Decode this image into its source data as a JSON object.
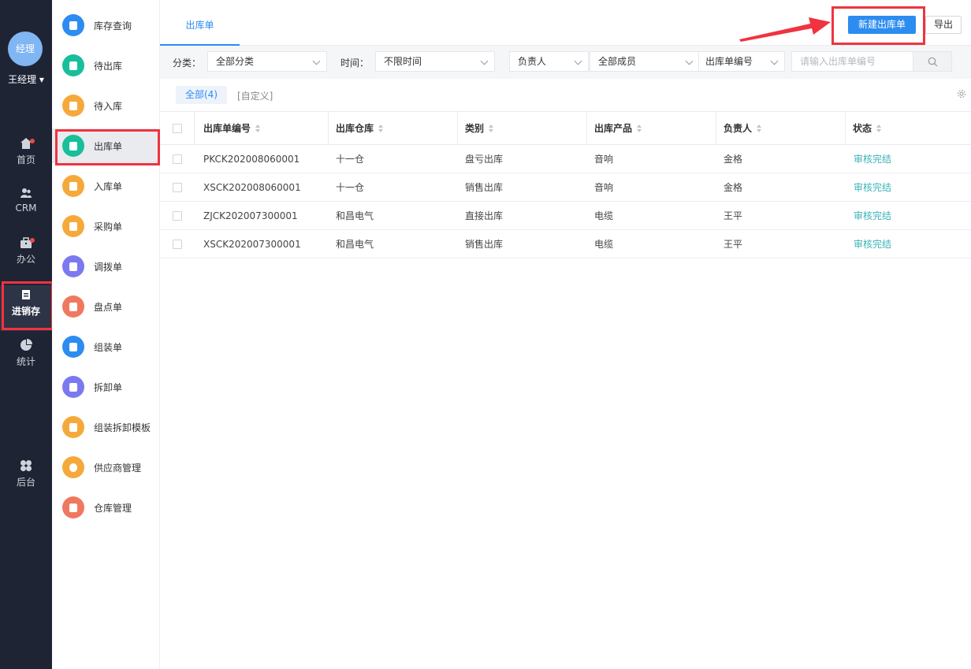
{
  "user": {
    "avatar_text": "经理",
    "name": "王经理 ▾"
  },
  "leftnav": [
    {
      "label": "首页",
      "icon": "home-icon",
      "badge": true
    },
    {
      "label": "CRM",
      "icon": "people-icon",
      "badge": false
    },
    {
      "label": "办公",
      "icon": "briefcase-icon",
      "badge": true
    },
    {
      "label": "进销存",
      "icon": "inventory-icon",
      "badge": false,
      "active": true
    },
    {
      "label": "统计",
      "icon": "pie-chart-icon",
      "badge": false
    },
    {
      "label": "后台",
      "icon": "admin-icon",
      "badge": false
    }
  ],
  "subnav": [
    {
      "label": "库存查询",
      "color": "#2d8cf0"
    },
    {
      "label": "待出库",
      "color": "#19be9b"
    },
    {
      "label": "待入库",
      "color": "#f6a93b"
    },
    {
      "label": "出库单",
      "color": "#19be9b",
      "active": true
    },
    {
      "label": "入库单",
      "color": "#f6a93b"
    },
    {
      "label": "采购单",
      "color": "#f6a93b"
    },
    {
      "label": "调拨单",
      "color": "#7b79f0"
    },
    {
      "label": "盘点单",
      "color": "#f07860"
    },
    {
      "label": "组装单",
      "color": "#2d8cf0"
    },
    {
      "label": "拆卸单",
      "color": "#7b79f0"
    },
    {
      "label": "组装拆卸模板",
      "color": "#f6a93b"
    },
    {
      "label": "供应商管理",
      "color": "#f6a93b"
    },
    {
      "label": "仓库管理",
      "color": "#f07860"
    }
  ],
  "header": {
    "tab": "出库单",
    "new_button": "新建出库单",
    "export_button": "导出"
  },
  "filters": {
    "category_label": "分类：",
    "category_value": "全部分类",
    "time_label": "时间：",
    "time_value": "不限时间",
    "owner_select": "负责人",
    "member_select": "全部成员",
    "field_select": "出库单编号",
    "search_placeholder": "请输入出库单编号"
  },
  "views": {
    "all": "全部(4)",
    "custom": "[自定义]"
  },
  "table": {
    "columns": [
      "出库单编号",
      "出库仓库",
      "类别",
      "出库产品",
      "负责人",
      "状态"
    ],
    "rows": [
      [
        "PKCK202008060001",
        "十一仓",
        "盘亏出库",
        "音响",
        "金格",
        "审核完结"
      ],
      [
        "XSCK202008060001",
        "十一仓",
        "销售出库",
        "音响",
        "金格",
        "审核完结"
      ],
      [
        "ZJCK202007300001",
        "和昌电气",
        "直接出库",
        "电缆",
        "王平",
        "审核完结"
      ],
      [
        "XSCK202007300001",
        "和昌电气",
        "销售出库",
        "电缆",
        "王平",
        "审核完结"
      ]
    ]
  },
  "colors": {
    "accent": "#2d8cf0",
    "highlight": "#f0333f",
    "status": "#3bb3b8",
    "sidebar": "#1f2434"
  }
}
